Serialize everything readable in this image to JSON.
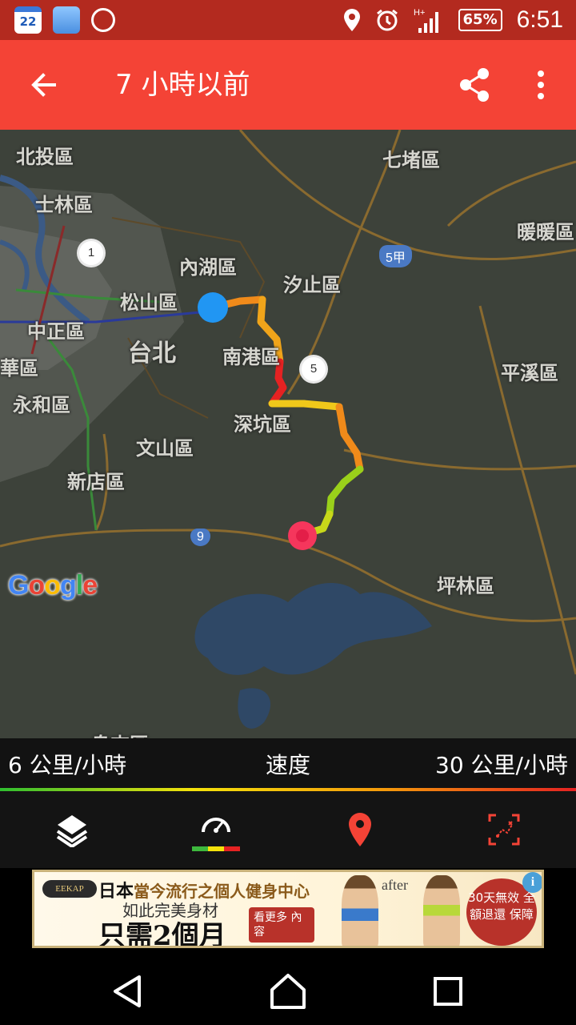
{
  "status_bar": {
    "calendar_day": "22",
    "battery": "65%",
    "time": "6:51",
    "network": "H+",
    "icons": [
      "calendar-icon",
      "weather-icon",
      "food-icon",
      "location-icon",
      "alarm-icon",
      "signal-icon",
      "battery-icon"
    ]
  },
  "app_bar": {
    "title": "7 小時以前",
    "back_icon": "arrow-back-icon",
    "share_icon": "share-icon",
    "more_icon": "more-vert-icon",
    "color": "#f44336"
  },
  "map": {
    "districts": [
      {
        "name": "北投區",
        "size": "normal"
      },
      {
        "name": "士林區",
        "size": "normal"
      },
      {
        "name": "七堵區",
        "size": "normal"
      },
      {
        "name": "暖暖區",
        "size": "normal"
      },
      {
        "name": "內湖區",
        "size": "normal"
      },
      {
        "name": "汐止區",
        "size": "normal"
      },
      {
        "name": "松山區",
        "size": "normal"
      },
      {
        "name": "中正區",
        "size": "normal"
      },
      {
        "name": "台北",
        "size": "big"
      },
      {
        "name": "南港區",
        "size": "normal"
      },
      {
        "name": "華區",
        "size": "normal"
      },
      {
        "name": "平溪區",
        "size": "normal"
      },
      {
        "name": "永和區",
        "size": "normal"
      },
      {
        "name": "深坑區",
        "size": "normal"
      },
      {
        "name": "文山區",
        "size": "normal"
      },
      {
        "name": "新店區",
        "size": "normal"
      },
      {
        "name": "坪林區",
        "size": "normal"
      },
      {
        "name": "烏來區",
        "size": "normal"
      }
    ],
    "route_shields": [
      "5甲",
      "9"
    ],
    "highway_markers": [
      "1",
      "5"
    ],
    "google_logo": "Google",
    "start_marker_color": "#2196f3",
    "end_marker_color": "#f5365c"
  },
  "speed_legend": {
    "min": "6 公里/小時",
    "label": "速度",
    "max": "30 公里/小時"
  },
  "tabs": [
    {
      "name": "layers",
      "icon": "layers-icon",
      "active": false
    },
    {
      "name": "speed",
      "icon": "speedometer-icon",
      "active": true
    },
    {
      "name": "location",
      "icon": "location-pin-icon",
      "active": false
    },
    {
      "name": "fit",
      "icon": "fit-route-icon",
      "active": false
    }
  ],
  "ad": {
    "logo": "EEKAP",
    "line1_a": "日本",
    "line1_b": "當今流行之個人健身中心",
    "line2": "如此完美身材",
    "line3": "只需2個月",
    "more": "看更多 內 容",
    "after": "after",
    "badge": "30天無效 全額退還 保障",
    "info": "i"
  },
  "nav": [
    "back-icon",
    "home-icon",
    "recents-icon"
  ]
}
